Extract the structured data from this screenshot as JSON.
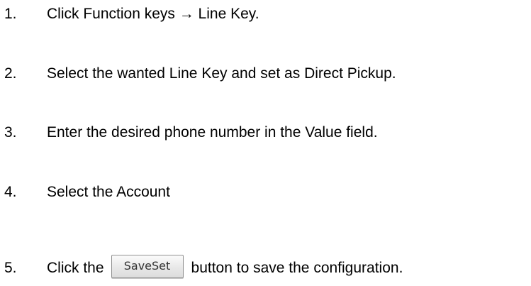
{
  "steps": [
    {
      "number": "1.",
      "text": "Click Function keys → Line Key."
    },
    {
      "number": "2.",
      "text": "Select the wanted Line Key and set as Direct Pickup."
    },
    {
      "number": "3.",
      "text": "Enter the desired phone number in the Value field."
    },
    {
      "number": "4.",
      "text": "Select the Account"
    },
    {
      "number": "5.",
      "text_before": "Click the",
      "button_label": "SaveSet",
      "text_after": "button to save the configuration."
    }
  ]
}
